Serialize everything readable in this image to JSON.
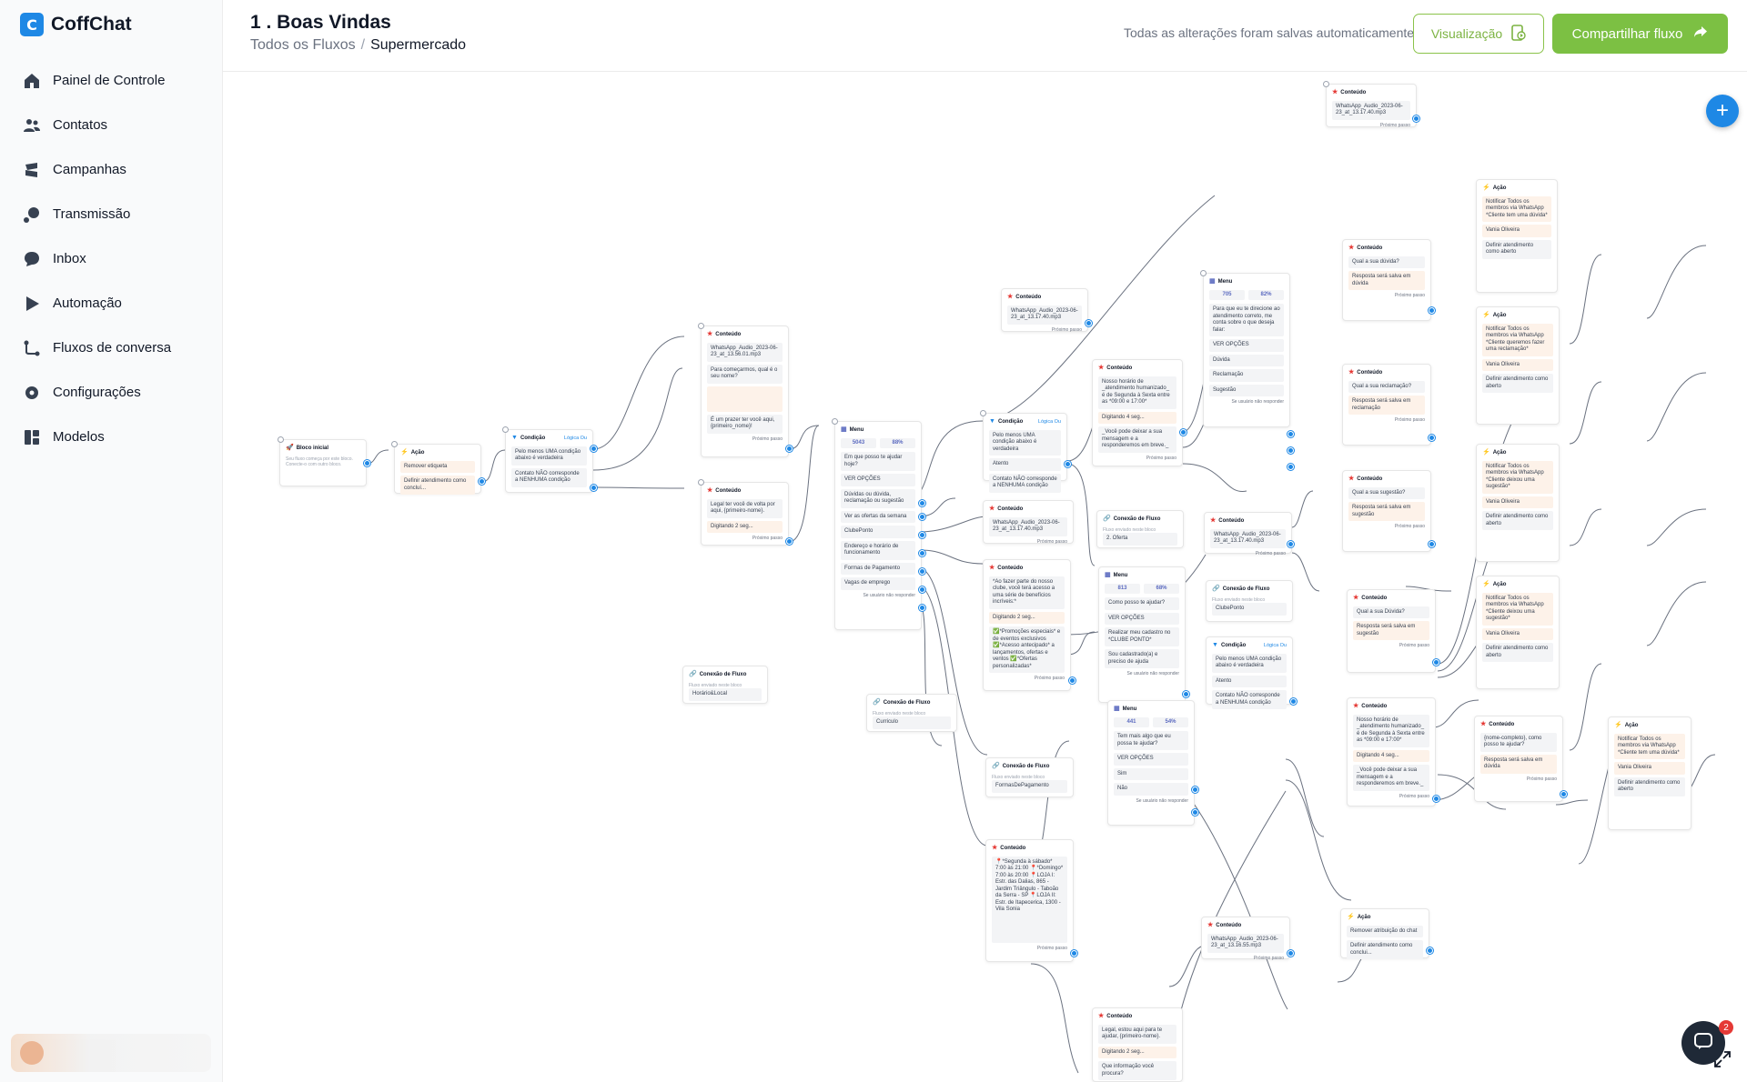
{
  "app": {
    "name": "CoffChat",
    "logo_glyph": "C"
  },
  "sidebar": {
    "items": [
      {
        "label": "Painel de Controle",
        "icon": "home-icon"
      },
      {
        "label": "Contatos",
        "icon": "users-icon"
      },
      {
        "label": "Campanhas",
        "icon": "megaphone-icon"
      },
      {
        "label": "Transmissão",
        "icon": "broadcast-icon"
      },
      {
        "label": "Inbox",
        "icon": "chat-bubble-icon"
      },
      {
        "label": "Automação",
        "icon": "play-icon"
      },
      {
        "label": "Fluxos de conversa",
        "icon": "flow-icon"
      },
      {
        "label": "Configurações",
        "icon": "gear-icon"
      },
      {
        "label": "Modelos",
        "icon": "grid-icon"
      }
    ]
  },
  "header": {
    "title": "1 . Boas Vindas",
    "breadcrumb": {
      "root": "Todos os Fluxos",
      "sep": "/",
      "current": "Supermercado"
    },
    "save_status": "Todas as alterações foram salvas automaticamente",
    "preview_label": "Visualização",
    "share_label": "Compartilhar fluxo"
  },
  "canvas": {
    "add_label": "+",
    "chat_badge": "2",
    "nodes": {
      "start": {
        "title": "Bloco inicial",
        "text": "Seu fluxo começa por este bloco. Conecte-o com outro bloco."
      },
      "action1": {
        "title": "Ação",
        "r1": "Remover etiqueta",
        "r2": "Definir atendimento como concluí..."
      },
      "cond1": {
        "title": "Condição",
        "tag": "Lógica Ou",
        "r1": "Pelo menos UMA condição abaixo é verdadeira",
        "r2": "Contato NÃO corresponde a NENHUMA condição"
      },
      "content1": {
        "title": "Conteúdo",
        "audio": "WhatsApp_Audio_2023-06-23_at_13.56.01.mp3",
        "r1": "Para começarmos, qual é o seu nome?",
        "r2": "É um prazer ter você aqui, {primeiro_nome}!",
        "next": "Próximo passo"
      },
      "content2": {
        "title": "Conteúdo",
        "r1": "Legal ter você de volta por aqui, {primeiro-nome}.",
        "r2": "Digitando 2 seg...",
        "next": "Próximo passo"
      },
      "linkL": {
        "title": "Conexão de Fluxo",
        "text": "Fluxo enviado neste bloco",
        "r1": "Horário&Local"
      },
      "content3": {
        "title": "Conteúdo",
        "audio": "WhatsApp_Audio_2023-06-23_at_13.17.40.mp3",
        "next": "Próximo passo"
      },
      "content4": {
        "title": "Conteúdo",
        "audio": "WhatsApp_Audio_2023-06-23_at_13.17.40.mp3",
        "next": "Próximo passo"
      },
      "menu1": {
        "title": "Menu",
        "s1": "5043",
        "s2": "88%",
        "q": "Em que posso te ajudar hoje?",
        "btn": "VER OPÇÕES",
        "o1": "Dúvidas ou dúvida, reclamação ou sugestão",
        "o2": "Ver as ofertas da semana",
        "o3": "ClubePonto",
        "o4": "Endereço e horário de funcionamento",
        "o5": "Formas de Pagamento",
        "o6": "Vagas de emprego",
        "o7": "Se usuário não responder"
      },
      "cond2": {
        "title": "Condição",
        "tag": "Lógica Ou",
        "r1": "Pelo menos UMA condição abaixo é verdadeira",
        "r2": "Atento",
        "r3": "Contato NÃO corresponde a NENHUMA condição"
      },
      "content5": {
        "title": "Conteúdo",
        "r1": "Nosso horário de _atendimento humanizado_ é de Segunda à Sexta entre as *09:00 e 17:00*",
        "r2": "Digitando 4 seg...",
        "r3": "_Você pode deixar a sua mensagem e a responderemos em breve._",
        "next": "Próximo passo"
      },
      "content6": {
        "title": "Conteúdo",
        "audio": "WhatsApp_Audio_2023-06-23_at_13.17.40.mp3",
        "next": "Próximo passo"
      },
      "link1": {
        "title": "Conexão de Fluxo",
        "text": "Fluxo enviado neste bloco",
        "r1": "2. Oferta"
      },
      "content7": {
        "title": "Conteúdo",
        "audio": "WhatsApp_Audio_2023-06-23_at_13.17.40.mp3",
        "next": "Próximo passo"
      },
      "menu2": {
        "title": "Menu",
        "s1": "705",
        "s2": "82%",
        "q": "Para que eu te direcione ao atendimento correto, me conta sobre o que deseja falar:",
        "btn": "VER OPÇÕES",
        "o1": "Dúvida",
        "o2": "Reclamação",
        "o3": "Sugestão",
        "o4": "Se usuário não responder"
      },
      "content8": {
        "title": "Conteúdo",
        "r1": "*Ao fazer parte do nosso clube, você terá acesso a uma série de benefícios incríveis:*",
        "r2": "Digitando 2 seg...",
        "r3": "✅*Promoções especiais* e de eventos exclusivos ✅*Acesso antecipado* a lançamentos, ofertas e ventos ✅*Ofertas personalizadas*",
        "next": "Próximo passo"
      },
      "menu3": {
        "title": "Menu",
        "s1": "813",
        "s2": "68%",
        "q": "Como posso te ajudar?",
        "btn": "VER OPÇÕES",
        "o1": "Realizar meu cadastro no *CLUBE PONTO*",
        "o2": "Sou cadastrado(a) e preciso de ajuda",
        "o3": "Se usuário não responder"
      },
      "link2": {
        "title": "Conexão de Fluxo",
        "text": "Fluxo enviado neste bloco",
        "r1": "ClubePonto"
      },
      "cond3": {
        "title": "Condição",
        "tag": "Lógica Ou",
        "r1": "Pelo menos UMA condição abaixo é verdadeira",
        "r2": "Atento",
        "r3": "Contato NÃO corresponde a NENHUMA condição"
      },
      "linkC": {
        "title": "Conexão de Fluxo",
        "text": "Fluxo enviado neste bloco",
        "r1": "Curriculo"
      },
      "link3": {
        "title": "Conexão de Fluxo",
        "text": "Fluxo enviado neste bloco",
        "r1": "FormasDePagamento"
      },
      "menu4": {
        "title": "Menu",
        "s1": "441",
        "s2": "54%",
        "q": "Tem mais algo que eu possa te ajudar?",
        "btn": "VER OPÇÕES",
        "o1": "Sim",
        "o2": "Não",
        "o3": "Se usuário não responder"
      },
      "content9": {
        "title": "Conteúdo",
        "r1": "📍*Segunda à sábado* 7:00 às 21:00 📍*Domingo* 7:00 às 20:00 📍LOJA I: Estr. das Dalias, 865 - Jardim Triângulo - Taboão da Serra - SP 📍LOJA II: Estr. de Itapecerica, 1300 - Vila Sonia",
        "next": "Próximo passo"
      },
      "content10": {
        "title": "Conteúdo",
        "audio": "WhatsApp_Audio_2023-06-23_at_13.16.55.mp3",
        "next": "Próximo passo"
      },
      "action2": {
        "title": "Ação",
        "r1": "Remover atribuição do chat",
        "r2": "Definir atendimento como conclui..."
      },
      "content11": {
        "title": "Conteúdo",
        "r1": "Legal, estou aqui para te ajudar, {primeiro-nome}.",
        "r2": "Digitando 2 seg...",
        "r3": "Que informação você procura?"
      },
      "cd1": {
        "title": "Conteúdo",
        "r1": "Qual a sua dúvida?",
        "r2": "Resposta será salva em dúvida",
        "next": "Próximo passo"
      },
      "cd2": {
        "title": "Conteúdo",
        "r1": "Qual a sua reclamação?",
        "r2": "Resposta será salva em reclamação",
        "next": "Próximo passo"
      },
      "cd3": {
        "title": "Conteúdo",
        "r1": "Qual a sua sugestão?",
        "r2": "Resposta será salva em sugestão",
        "next": "Próximo passo"
      },
      "cd4": {
        "title": "Conteúdo",
        "r1": "Qual a sua Dúvida?",
        "r2": "Resposta será salva em sugestão",
        "next": "Próximo passo"
      },
      "cd5": {
        "title": "Conteúdo",
        "r1": "Nosso horário de _atendimento humanizado_ é de Segunda à Sexta entre as *09:00 e 17:00*",
        "r2": "Digitando 4 seg...",
        "r3": "_Você pode deixar a sua mensagem e a responderemos em breve._",
        "next": "Próximo passo"
      },
      "cd6": {
        "title": "Conteúdo",
        "r1": "{nome-completo}, como posso te ajudar?",
        "r2": "Resposta será salva em dúvida",
        "next": "Próximo passo"
      },
      "ac1": {
        "title": "Ação",
        "r1": "Notificar Todos os membros via WhatsApp *Cliente tem uma dúvida*",
        "r2": "Vania Oliveira",
        "r3": "Definir atendimento como aberto"
      },
      "ac2": {
        "title": "Ação",
        "r1": "Notificar Todos os membros via WhatsApp *Cliente queremos fazer uma reclamação*",
        "r2": "Vania Oliveira",
        "r3": "Definir atendimento como aberto"
      },
      "ac3": {
        "title": "Ação",
        "r1": "Notificar Todos os membros via WhatsApp *Cliente deixou uma sugestão*",
        "r2": "Vania Oliveira",
        "r3": "Definir atendimento como aberto"
      },
      "ac4": {
        "title": "Ação",
        "r1": "Notificar Todos os membros via WhatsApp *Cliente deixou uma sugestão*",
        "r2": "Vania Oliveira",
        "r3": "Definir atendimento como aberto"
      },
      "ac5": {
        "title": "Ação",
        "r1": "Notificar Todos os membros via WhatsApp *Cliente tem uma dúvida*",
        "r2": "Vania Oliveira",
        "r3": "Definir atendimento como aberto"
      }
    }
  },
  "colors": {
    "accent": "#1e88e5",
    "green": "#7cc043",
    "red": "#e53935"
  }
}
